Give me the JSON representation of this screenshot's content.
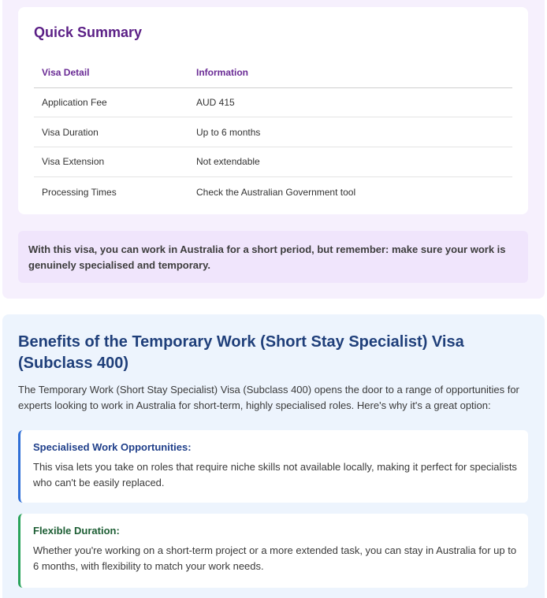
{
  "summary": {
    "title": "Quick Summary",
    "table": {
      "headers": [
        "Visa Detail",
        "Information"
      ],
      "rows": [
        [
          "Application Fee",
          "AUD 415"
        ],
        [
          "Visa Duration",
          "Up to 6 months"
        ],
        [
          "Visa Extension",
          "Not extendable"
        ],
        [
          "Processing Times",
          "Check the Australian Government tool"
        ]
      ]
    },
    "note": "With this visa, you can work in Australia for a short period, but remember: make sure your work is genuinely specialised and temporary."
  },
  "benefits": {
    "title": "Benefits of the Temporary Work (Short Stay Specialist) Visa (Subclass 400)",
    "intro": "The Temporary Work (Short Stay Specialist) Visa (Subclass 400) opens the door to a range of opportunities for experts looking to work in Australia for short-term, highly specialised roles. Here's why it's a great option:",
    "items": [
      {
        "heading": "Specialised Work Opportunities:",
        "text": "This visa lets you take on roles that require niche skills not available locally, making it perfect for specialists who can't be easily replaced.",
        "accent": "#2f6fd6"
      },
      {
        "heading": "Flexible Duration:",
        "text": "Whether you're working on a short-term project or a more extended task, you can stay in Australia for up to 6 months, with flexibility to match your work needs.",
        "accent": "#2aa35b"
      }
    ]
  }
}
